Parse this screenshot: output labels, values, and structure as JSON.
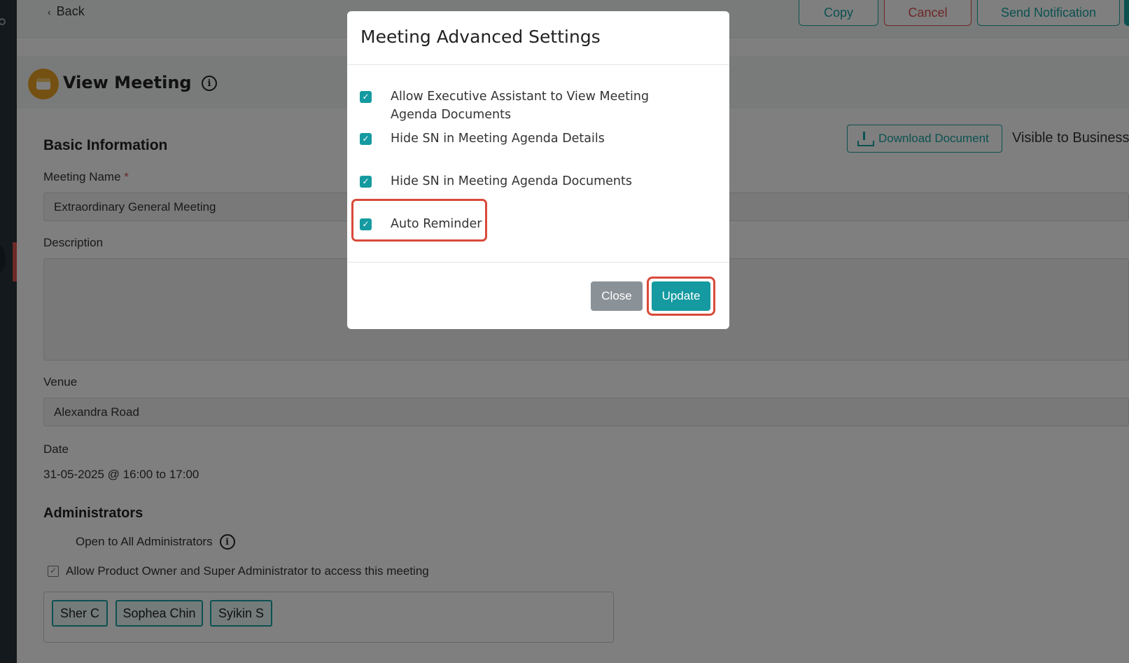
{
  "header": {
    "back_label": "Back",
    "copy_label": "Copy",
    "cancel_label": "Cancel",
    "notify_label": "Send Notification"
  },
  "page": {
    "title": "View Meeting",
    "info_glyph": "i",
    "basic_info_heading": "Basic Information",
    "download_label": "Download Document",
    "visible_to_label": "Visible to Business",
    "meeting_name_label": "Meeting Name",
    "required_mark": "*",
    "meeting_name_value": "Extraordinary General Meeting",
    "description_label": "Description",
    "description_value": "",
    "venue_label": "Venue",
    "venue_value": "Alexandra Road",
    "date_label": "Date",
    "date_value": "31-05-2025 @ 16:00 to 17:00",
    "admins_heading": "Administrators",
    "open_to_all_label": "Open to All Administrators",
    "allow_owner_label": "Allow Product Owner and Super Administrator to access this meeting",
    "admins": [
      "Sher C",
      "Sophea Chin",
      "Syikin S"
    ]
  },
  "modal": {
    "title": "Meeting Advanced Settings",
    "options": [
      {
        "label": "Allow Executive Assistant to View Meeting Agenda Documents",
        "checked": true
      },
      {
        "label": "Hide SN in Meeting Agenda Details",
        "checked": true
      },
      {
        "label": "Hide SN in Meeting Agenda Documents",
        "checked": true
      },
      {
        "label": "Auto Reminder",
        "checked": true
      }
    ],
    "close_label": "Close",
    "update_label": "Update"
  },
  "colors": {
    "accent": "#149aa0",
    "danger": "#d9534f",
    "highlight": "#d94a3a"
  }
}
